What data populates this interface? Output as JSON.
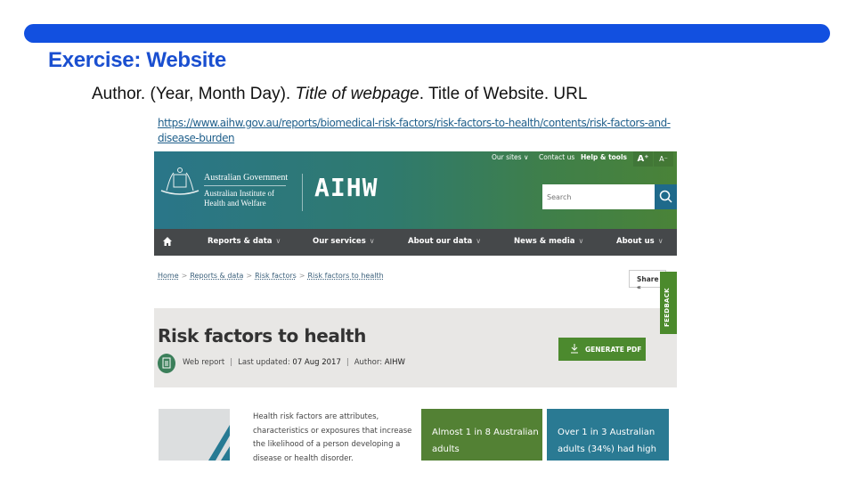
{
  "slide": {
    "title": "Exercise: Website",
    "citation": {
      "part1": "Author. (Year, Month Day). ",
      "italic": "Title of webpage",
      "part2": ". Title of Website. URL"
    },
    "url": "https://www.aihw.gov.au/reports/biomedical-risk-factors/risk-factors-to-health/contents/risk-factors-and-disease-burden"
  },
  "site": {
    "header": {
      "gov_name": "Australian Government",
      "institute_name": "Australian Institute of Health and Welfare",
      "logo_text": "AIHW",
      "utility_links": [
        "Our sites ∨",
        "Contact us",
        "Help & tools"
      ],
      "font_increase": "A⁺",
      "font_decrease": "A⁻",
      "search_placeholder": "Search"
    },
    "nav": {
      "items": [
        {
          "label": "Reports & data",
          "chevron": "∨"
        },
        {
          "label": "Our services",
          "chevron": "∨"
        },
        {
          "label": "About our data",
          "chevron": "∨"
        },
        {
          "label": "News & media",
          "chevron": "∨"
        },
        {
          "label": "About us",
          "chevron": "∨"
        }
      ]
    },
    "breadcrumb": [
      "Home",
      "Reports & data",
      "Risk factors",
      "Risk factors to health"
    ],
    "breadcrumb_sep": ">",
    "share_label": "Share «",
    "feedback_label": "FEEDBACK",
    "page": {
      "title": "Risk factors to health",
      "type": "Web report",
      "updated_label": "Last updated: ",
      "updated_date": "07 Aug 2017",
      "author_label": "Author: ",
      "author": "AIHW",
      "generate_pdf": "GENERATE PDF"
    },
    "intro_text": "Health risk factors are attributes, characteristics or exposures that increase the likelihood of a person developing a disease or health disorder.",
    "stats": [
      "Almost 1 in 8 Australian adults",
      "Over 1 in 3 Australian adults (34%) had high"
    ]
  },
  "colors": {
    "slide_accent": "#1250e0",
    "header_teal": "#2a7689",
    "header_green": "#4a8338",
    "nav_bg": "#45484a",
    "action_green": "#4c8a2e",
    "stat_blue": "#2a7a93"
  }
}
